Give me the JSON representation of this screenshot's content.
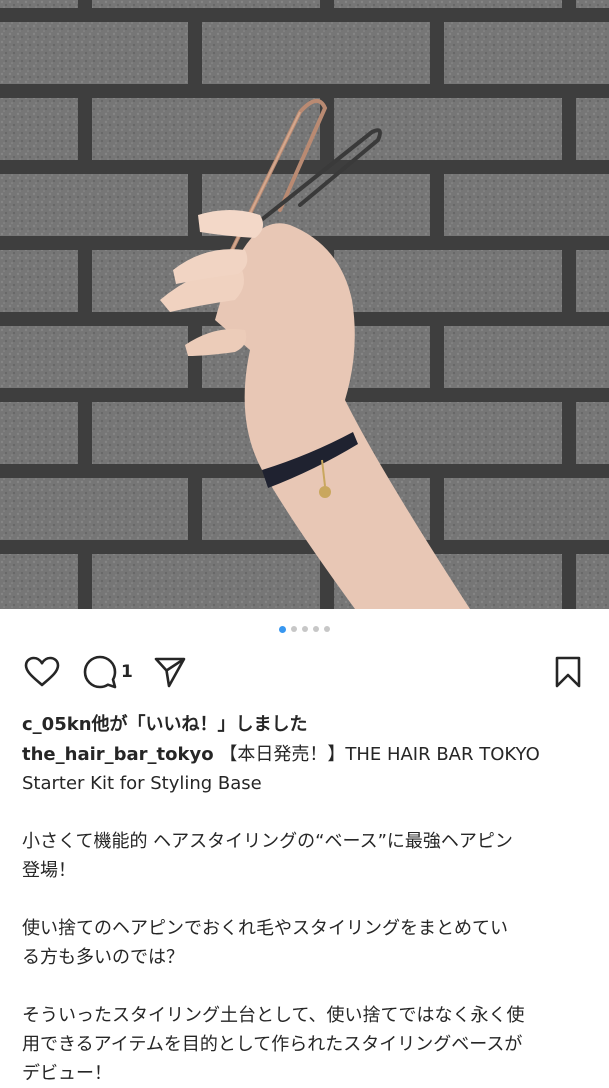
{
  "post": {
    "carousel": {
      "count": 5,
      "active_index": 0
    },
    "comment_count": "1",
    "likes_text": "c_05kn他が「いいね！」しました",
    "caption": {
      "username": "the_hair_bar_tokyo",
      "title_line1": "【本日発売！】THE HAIR BAR TOKYO",
      "title_line2": "Starter Kit for Styling Base",
      "para1_line1": "小さくて機能的 ヘアスタイリングの“ベース”に最強ヘアピン",
      "para1_line2": "登場！",
      "para2_line1": "使い捨てのヘアピンでおくれ毛やスタイリングをまとめてい",
      "para2_line2": "る方も多いのでは？",
      "para3_line1": "そういったスタイリング土台として、使い捨てではなく永く使",
      "para3_line2": "用できるアイテムを目的として作られたスタイリングベースが",
      "para3_line3": "デビュー！"
    }
  },
  "icons": {
    "like": "heart-icon",
    "comment": "comment-icon",
    "share": "send-icon",
    "save": "bookmark-icon"
  },
  "colors": {
    "text": "#262626",
    "active_dot": "#3897f0",
    "inactive_dot": "#c7c7c7",
    "wall": "#6f6f6f",
    "mortar": "#3e3e3e"
  }
}
